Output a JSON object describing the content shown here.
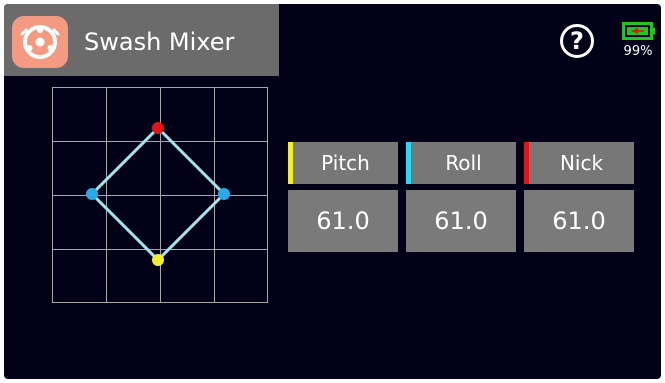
{
  "header": {
    "title": "Swash Mixer",
    "app_icon": "swash-mixer-icon",
    "help_symbol": "?",
    "battery_percent": "99%",
    "battery_icon": "battery-charging-icon"
  },
  "colors": {
    "background": "#020118",
    "title_bar": "#6b6b6b",
    "app_icon": "#f49a82",
    "pitch": "#f2ee2e",
    "roll": "#29d7f2",
    "nick": "#e31414",
    "diamond": "#9fe6ee",
    "battery": "#23c41f"
  },
  "channels": [
    {
      "label": "Pitch",
      "value": "61.0",
      "color": "#f2ee2e"
    },
    {
      "label": "Roll",
      "value": "61.0",
      "color": "#29d7f2"
    },
    {
      "label": "Nick",
      "value": "61.0",
      "color": "#e31414"
    }
  ]
}
